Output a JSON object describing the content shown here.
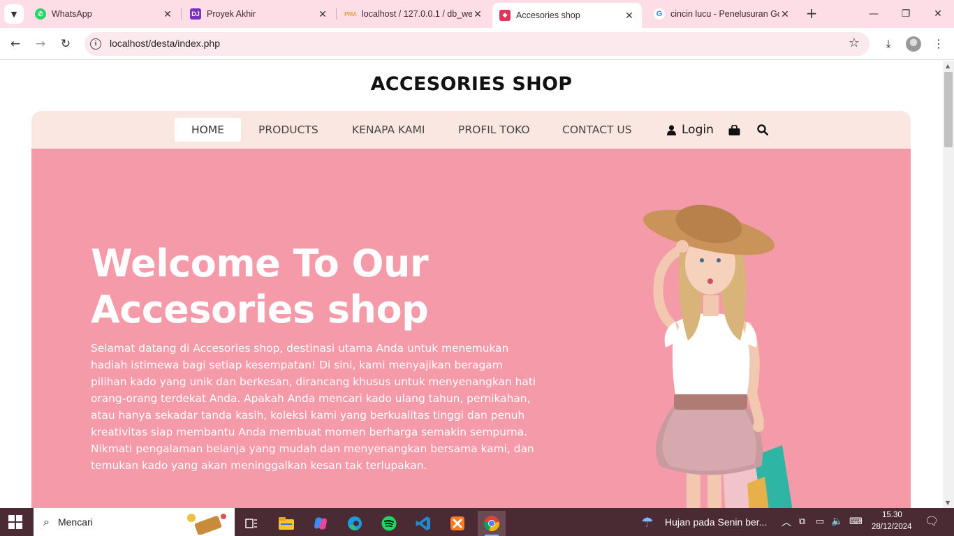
{
  "browser": {
    "tabs": [
      {
        "title": "WhatsApp",
        "favicon": "whatsapp-icon"
      },
      {
        "title": "Proyek Akhir",
        "favicon": "dj-icon"
      },
      {
        "title": "localhost / 127.0.0.1 / db_we",
        "favicon": "phpmyadmin-icon"
      },
      {
        "title": "Accesories shop",
        "favicon": "gift-icon",
        "active": true
      },
      {
        "title": "cincin lucu - Penelusuran Go",
        "favicon": "google-icon"
      }
    ],
    "url": "localhost/desta/index.php"
  },
  "site": {
    "title": "ACCESORIES SHOP",
    "nav": {
      "home": "HOME",
      "products": "PRODUCTS",
      "kenapa_kami": "KENAPA KAMI",
      "profil_toko": "PROFIL TOKO",
      "contact_us": "CONTACT US",
      "login": "Login"
    },
    "hero": {
      "title_line1": "Welcome To Our",
      "title_line2": "Accesories shop",
      "text": "Selamat datang di Accesories shop, destinasi utama Anda untuk menemukan hadiah istimewa bagi setiap kesempatan! Di sini, kami menyajikan beragam pilihan kado yang unik dan berkesan, dirancang khusus untuk menyenangkan hati orang-orang terdekat Anda. Apakah Anda mencari kado ulang tahun, pernikahan, atau hanya sekadar tanda kasih, koleksi kami yang berkualitas tinggi dan penuh kreativitas siap membantu Anda membuat momen berharga semakin sempurna. Nikmati pengalaman belanja yang mudah dan menyenangkan bersama kami, dan temukan kado yang akan meninggalkan kesan tak terlupakan."
    }
  },
  "taskbar": {
    "search_placeholder": "Mencari",
    "weather": "Hujan pada Senin ber...",
    "time": "15.30",
    "date": "28/12/2024"
  },
  "colors": {
    "hero_bg": "#f59aa8",
    "navbar_bg": "#fbe7e2",
    "tabbar_bg": "#fddde6",
    "taskbar_bg": "#4a2a33"
  }
}
